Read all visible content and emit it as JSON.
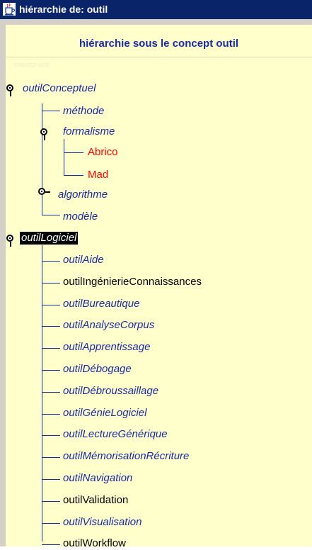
{
  "window": {
    "title": "hiérarchie de: outil"
  },
  "panel": {
    "subtitle": "hiérarchie sous le concept outil",
    "faint_text": "concept outil"
  },
  "tree": {
    "root1": {
      "label": "outilConceptuel",
      "children": [
        "méthode",
        "formalisme",
        "algorithme",
        "modèle"
      ],
      "formalisme_children": [
        "Abrico",
        "Mad"
      ]
    },
    "root2": {
      "label": "outilLogiciel",
      "children": [
        "outilAide",
        "outilIngénierieConnaissances",
        "outilBureautique",
        "outilAnalyseCorpus",
        "outilApprentissage",
        "outilDébogage",
        "outilDébroussaillage",
        "outilGénieLogiciel",
        "outilLectureGénérique",
        "outilMémorisationRécriture",
        "outilNavigation",
        "outilValidation",
        "outilVisualisation",
        "outilWorkflow"
      ]
    }
  },
  "colors": {
    "concept": "#1a2aa0",
    "instance": "#ff0000",
    "background": "#ffffcc",
    "titlebar": "#0a246a"
  },
  "icons": {
    "app": "java-cup-icon",
    "expanded": "handle-expanded-icon",
    "collapsed": "handle-collapsed-icon"
  }
}
